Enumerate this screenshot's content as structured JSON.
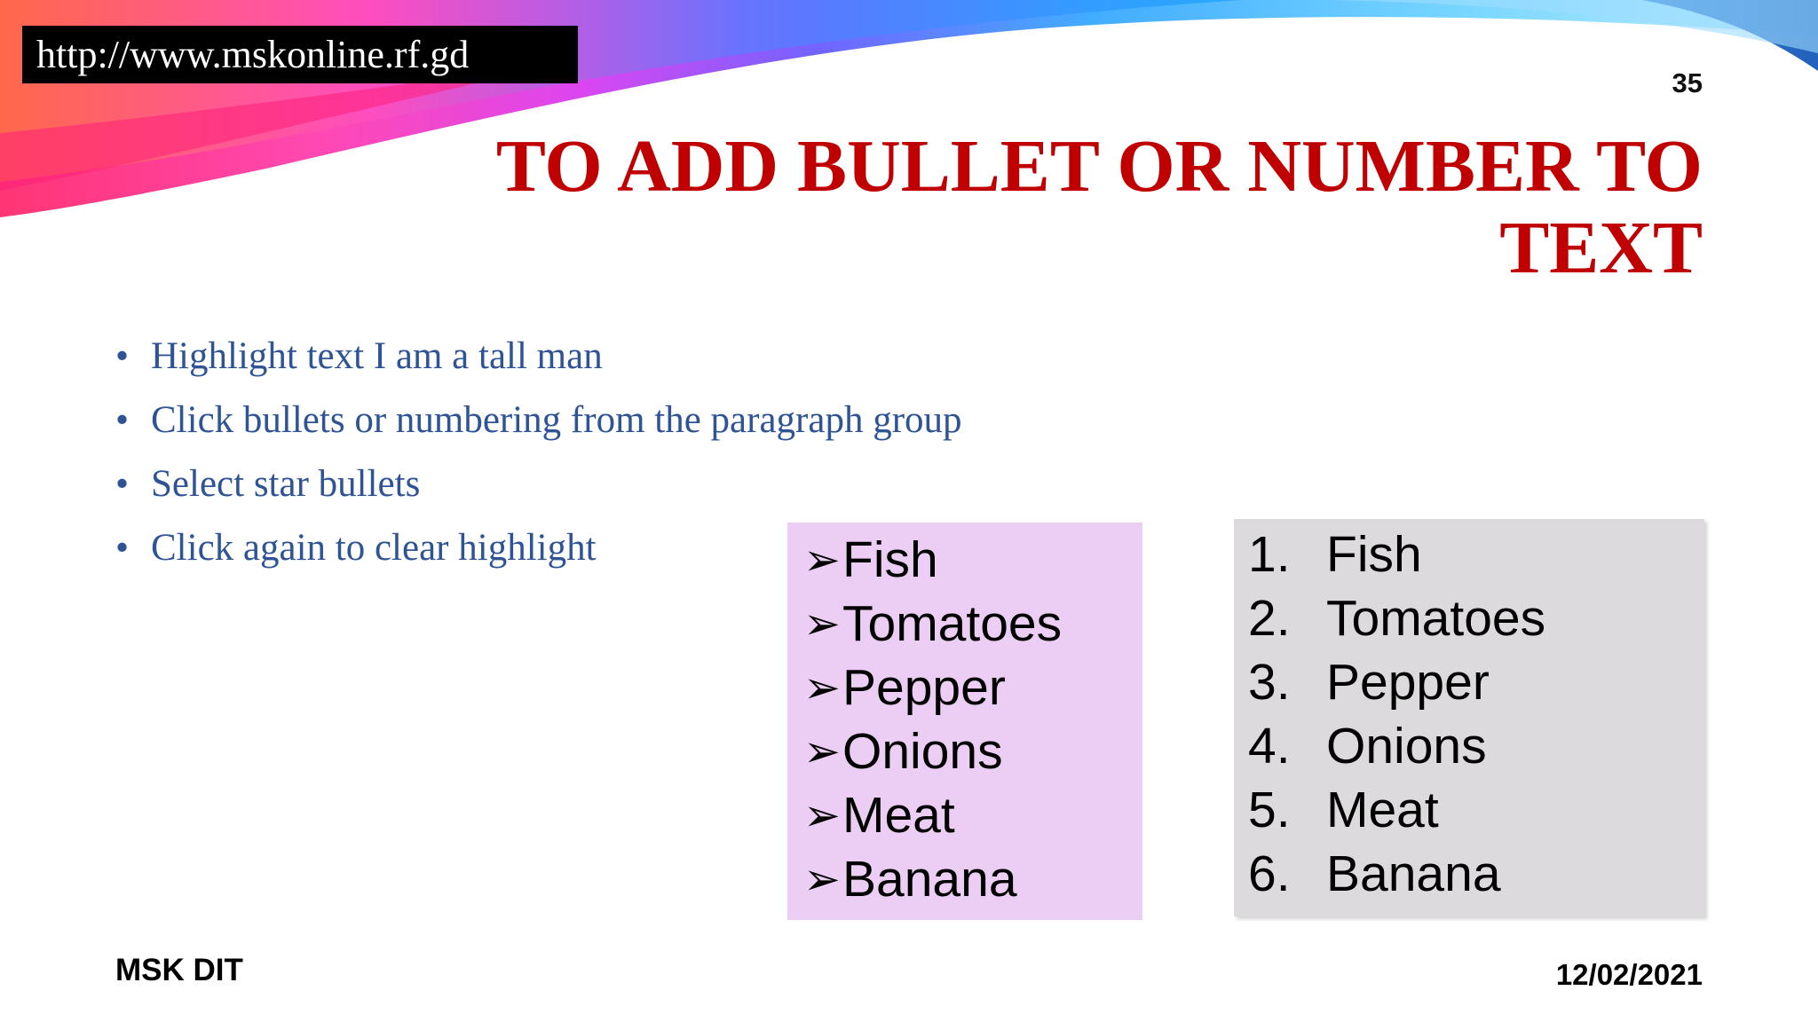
{
  "header": {
    "url": "http://www.mskonline.rf.gd",
    "slide_number": "35"
  },
  "title": {
    "line1": "TO ADD BULLET OR NUMBER TO",
    "line2": "TEXT"
  },
  "bullets": [
    "Highlight text I am a tall man",
    "Click bullets or numbering from the paragraph group",
    "Select star bullets",
    "Click again to clear highlight"
  ],
  "bullet_list": {
    "marker": "➢",
    "items": [
      "Fish",
      "Tomatoes",
      "Pepper",
      "Onions",
      "Meat",
      "Banana"
    ]
  },
  "numbered_list": {
    "numbers": [
      "1.",
      "2.",
      "3.",
      "4.",
      "5.",
      "6."
    ],
    "items": [
      "Fish",
      "Tomatoes",
      "Pepper",
      "Onions",
      "Meat",
      "Banana"
    ]
  },
  "footer": {
    "left": "MSK DIT",
    "date": "12/02/2021"
  },
  "colors": {
    "title": "#c00000",
    "body_text": "#2f5496",
    "bullet_box_bg": "#eccdf3",
    "number_box_bg": "#dcdadc"
  }
}
